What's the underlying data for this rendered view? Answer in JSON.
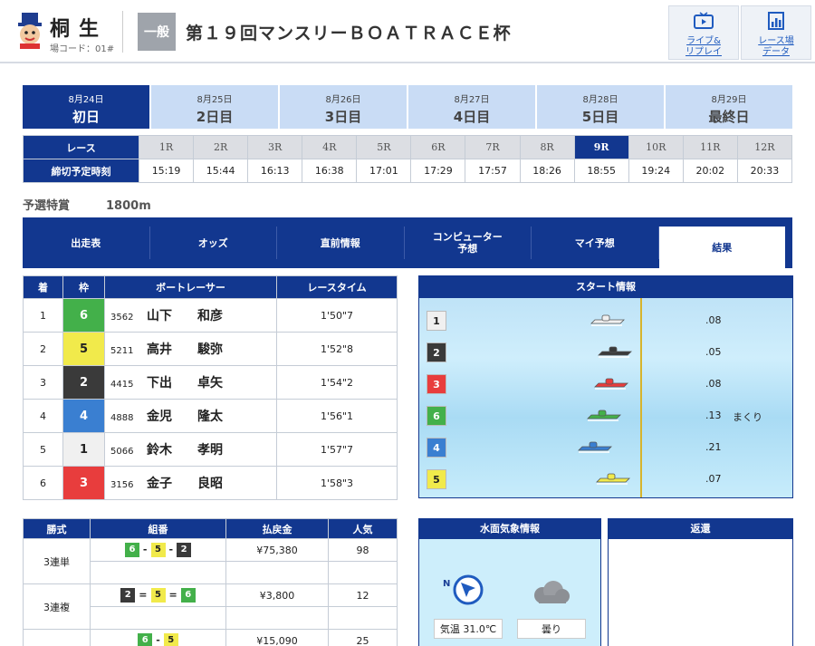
{
  "header": {
    "venue": "桐生",
    "venue_code": "場コード：01#",
    "grade": "一般",
    "title": "第１９回マンスリーＢＯＡＴＲＡＣＥ杯",
    "buttons": [
      {
        "label": "ライブ&\nリプレイ",
        "icon": "tv-icon"
      },
      {
        "label": "レース場\nデータ",
        "icon": "bar-chart-icon"
      }
    ]
  },
  "days": [
    {
      "date": "8月24日",
      "label": "初日",
      "active": true
    },
    {
      "date": "8月25日",
      "label": "2日目"
    },
    {
      "date": "8月26日",
      "label": "3日目"
    },
    {
      "date": "8月27日",
      "label": "4日目"
    },
    {
      "date": "8月28日",
      "label": "5日目"
    },
    {
      "date": "8月29日",
      "label": "最終日"
    }
  ],
  "race_table": {
    "race_label": "レース",
    "time_label": "締切予定時刻",
    "races": [
      "1R",
      "2R",
      "3R",
      "4R",
      "5R",
      "6R",
      "7R",
      "8R",
      "9R",
      "10R",
      "11R",
      "12R"
    ],
    "times": [
      "15:19",
      "15:44",
      "16:13",
      "16:38",
      "17:01",
      "17:29",
      "17:57",
      "18:26",
      "18:55",
      "19:24",
      "20:02",
      "20:33"
    ],
    "active_index": 8
  },
  "race_info": {
    "name": "予選特賞",
    "distance": "1800m"
  },
  "tabs": [
    "出走表",
    "オッズ",
    "直前情報",
    "コンピューター\n予想",
    "マイ予想",
    "結果"
  ],
  "active_tab": 5,
  "results": {
    "headers": [
      "着",
      "枠",
      "ボートレーサー",
      "レースタイム"
    ],
    "rows": [
      {
        "place": "1",
        "lane": "6",
        "id": "3562",
        "name": "山下　　和彦",
        "time": "1'50\"7"
      },
      {
        "place": "2",
        "lane": "5",
        "id": "5211",
        "name": "高井　　駿弥",
        "time": "1'52\"8"
      },
      {
        "place": "3",
        "lane": "2",
        "id": "4415",
        "name": "下出　　卓矢",
        "time": "1'54\"2"
      },
      {
        "place": "4",
        "lane": "4",
        "id": "4888",
        "name": "金児　　隆太",
        "time": "1'56\"1"
      },
      {
        "place": "5",
        "lane": "1",
        "id": "5066",
        "name": "鈴木　　孝明",
        "time": "1'57\"7"
      },
      {
        "place": "6",
        "lane": "3",
        "id": "3156",
        "name": "金子　　良昭",
        "time": "1'58\"3"
      }
    ]
  },
  "start_info": {
    "title": "スタート情報",
    "rows": [
      {
        "lane": "1",
        "st": ".08",
        "note": ""
      },
      {
        "lane": "2",
        "st": ".05",
        "note": ""
      },
      {
        "lane": "3",
        "st": ".08",
        "note": ""
      },
      {
        "lane": "6",
        "st": ".13",
        "note": "まくり"
      },
      {
        "lane": "4",
        "st": ".21",
        "note": ""
      },
      {
        "lane": "5",
        "st": ".07",
        "note": ""
      }
    ]
  },
  "payouts": {
    "headers": [
      "勝式",
      "組番",
      "払戻金",
      "人気"
    ],
    "rows": [
      {
        "kind": "3連単",
        "combo": [
          "6",
          "5",
          "2"
        ],
        "sep": "-",
        "amount": "¥75,380",
        "pop": "98"
      },
      {
        "kind": "3連複",
        "combo": [
          "2",
          "5",
          "6"
        ],
        "sep": "=",
        "amount": "¥3,800",
        "pop": "12"
      },
      {
        "kind": "",
        "combo": [
          "6",
          "5"
        ],
        "sep": "-",
        "amount": "¥15,090",
        "pop": "25"
      }
    ]
  },
  "weather": {
    "title": "水面気象情報",
    "north": "N",
    "temp": "気温 31.0℃",
    "sky": "曇り"
  },
  "refund": {
    "title": "返還"
  },
  "lane_colors": {
    "1": "#f0f0f0",
    "2": "#3a3a3a",
    "3": "#e83d3d",
    "4": "#3a7fd1",
    "5": "#f1ea4b",
    "6": "#43b04a"
  }
}
